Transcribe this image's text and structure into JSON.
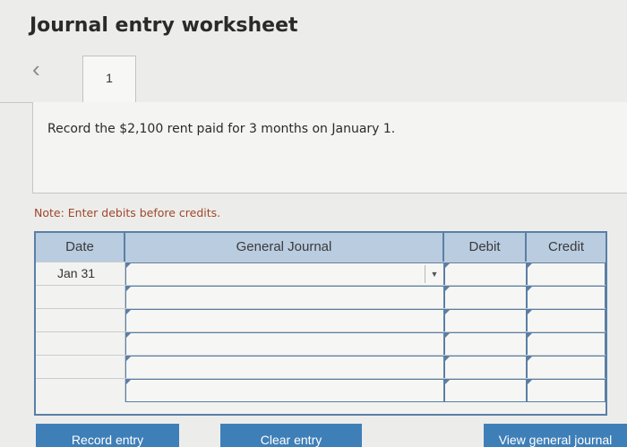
{
  "header": {
    "title": "Journal entry worksheet"
  },
  "nav": {
    "back_icon": "chevron-left-icon",
    "tab_label": "1"
  },
  "prompt": {
    "text": "Record the $2,100 rent paid for 3 months on January 1."
  },
  "note": {
    "text": "Note: Enter debits before credits."
  },
  "journal": {
    "headers": {
      "date": "Date",
      "general_journal": "General Journal",
      "debit": "Debit",
      "credit": "Credit"
    },
    "rows": [
      {
        "date": "Jan 31",
        "account": "",
        "debit": "",
        "credit": ""
      },
      {
        "date": "",
        "account": "",
        "debit": "",
        "credit": ""
      },
      {
        "date": "",
        "account": "",
        "debit": "",
        "credit": ""
      },
      {
        "date": "",
        "account": "",
        "debit": "",
        "credit": ""
      },
      {
        "date": "",
        "account": "",
        "debit": "",
        "credit": ""
      },
      {
        "date": "",
        "account": "",
        "debit": "",
        "credit": ""
      }
    ]
  },
  "buttons": {
    "record": "Record entry",
    "clear": "Clear entry",
    "view": "View general journal"
  },
  "colors": {
    "accent": "#3f7fb8",
    "grid_border": "#5a7fa6",
    "header_bg": "#b9cce0",
    "note": "#a0462a"
  }
}
